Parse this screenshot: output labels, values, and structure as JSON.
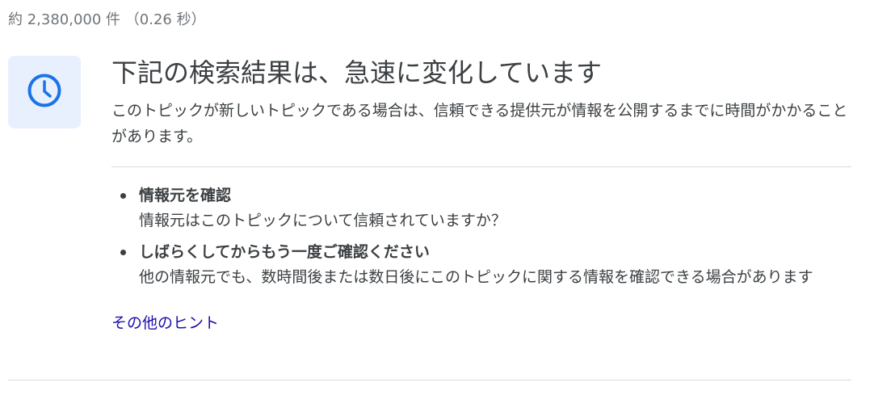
{
  "result_stats": "約 2,380,000 件 （0.26 秒）",
  "notice": {
    "icon": "clock-icon",
    "title": "下記の検索結果は、急速に変化しています",
    "description": "このトピックが新しいトピックである場合は、信頼できる提供元が情報を公開するまでに時間がかかることがあります。",
    "tips": [
      {
        "title": "情報元を確認",
        "description": "情報元はこのトピックについて信頼されていますか？"
      },
      {
        "title": "しばらくしてからもう一度ご確認ください",
        "description": "他の情報元でも、数時間後または数日後にこのトピックに関する情報を確認できる場合があります"
      }
    ],
    "more_link": "その他のヒント"
  },
  "colors": {
    "icon_bg": "#e8f0fe",
    "icon_accent": "#1a73e8",
    "link": "#1a0dab",
    "text": "#3c4043",
    "muted": "#70757a",
    "divider": "#dadce0"
  }
}
